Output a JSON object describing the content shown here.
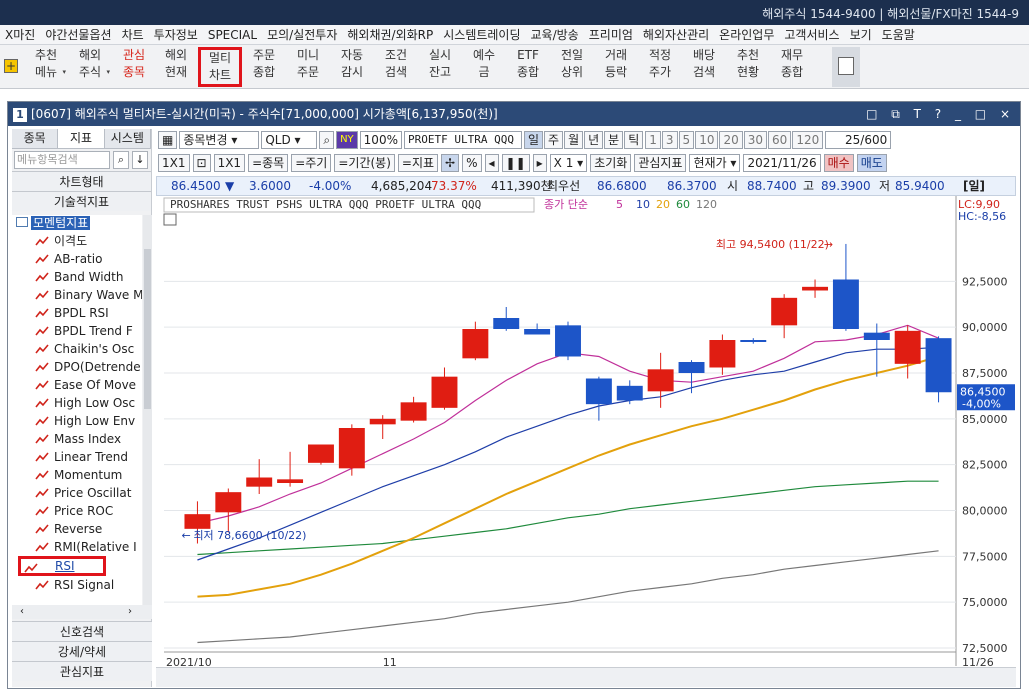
{
  "topbar": {
    "right": "해외주식 1544-9400 | 해외선물/FX마진 1544-9"
  },
  "menu": [
    "X마진",
    "야간선물옵션",
    "차트",
    "투자정보",
    "SPECIAL",
    "모의/실전투자",
    "해외채권/외화RP",
    "시스템트레이딩",
    "교육/방송",
    "프리미엄",
    "해외자산관리",
    "온라인업무",
    "고객서비스",
    "보기",
    "도움말"
  ],
  "toolbar": [
    {
      "l1": "추천",
      "l2": "메뉴",
      "dd": "▾"
    },
    {
      "l1": "해외",
      "l2": "주식",
      "dd": "▾"
    },
    {
      "l1": "관심",
      "l2": "종목",
      "red": true
    },
    {
      "l1": "해외",
      "l2": "현재"
    },
    {
      "l1": "멀티",
      "l2": "차트",
      "sel": true
    },
    {
      "l1": "주문",
      "l2": "종합"
    },
    {
      "l1": "미니",
      "l2": "주문"
    },
    {
      "l1": "자동",
      "l2": "감시"
    },
    {
      "l1": "조건",
      "l2": "검색"
    },
    {
      "l1": "실시",
      "l2": "잔고"
    },
    {
      "l1": "예수",
      "l2": "금"
    },
    {
      "l1": "ETF",
      "l2": "종합"
    },
    {
      "l1": "전일",
      "l2": "상위"
    },
    {
      "l1": "거래",
      "l2": "등락"
    },
    {
      "l1": "적정",
      "l2": "주가"
    },
    {
      "l1": "배당",
      "l2": "검색"
    },
    {
      "l1": "추천",
      "l2": "현황"
    },
    {
      "l1": "재무",
      "l2": "종합"
    }
  ],
  "window": {
    "num": "1",
    "title": "[0607] 해외주식 멀티차트-실시간(미국) - 주식수[71,000,000] 시가총액[6,137,950(천)]",
    "controls": "□ ⧉ T ? _ □ ×"
  },
  "left": {
    "tabs": [
      "종목",
      "지표",
      "시스템"
    ],
    "search_placeholder": "메뉴항목검색",
    "btn1": "차트형태",
    "btn2": "기술적지표",
    "root": "모멘텀지표",
    "items": [
      "이격도",
      "AB-ratio",
      "Band Width",
      "Binary Wave M",
      "BPDL RSI",
      "BPDL Trend F",
      "Chaikin's Osc",
      "DPO(Detrende",
      "Ease Of Move",
      "High Low Osc",
      "High Low Env",
      "Mass Index",
      "Linear Trend",
      "Momentum",
      "Price Oscillat",
      "Price ROC",
      "Reverse",
      "RMI(Relative I",
      "RSI",
      "RSI Signal"
    ],
    "selected": "RSI",
    "bottom": [
      "신호검색",
      "강세/약세",
      "관심지표"
    ]
  },
  "controls1": {
    "dropdown": "종목변경",
    "code": "QLD",
    "ny": "NY",
    "pct": "100%",
    "name": "PROETF ULTRA QQQ",
    "periods": [
      "일",
      "주",
      "월",
      "년",
      "분",
      "틱"
    ],
    "nums": [
      "1",
      "3",
      "5",
      "10",
      "20",
      "30",
      "60",
      "120"
    ],
    "count": "25/600"
  },
  "controls2": {
    "a": "1X1",
    "b": "1X1",
    "c": "=종목",
    "d": "=주기",
    "e": "=기간(봉)",
    "f": "=지표",
    "x": "X 1",
    "reset": "초기화",
    "interest": "관심지표",
    "price": "현재가",
    "date": "2021/11/26",
    "buy": "매수",
    "sell": "매도"
  },
  "quote": {
    "price": "86.4500",
    "arrow": "▼",
    "chg": "3.6000",
    "pct": "-4.00%",
    "vol": "4,685,204",
    "ratio": "73.37%",
    "amt": "411,390천",
    "best_label": "최우선",
    "ask": "86.6800",
    "bid": "86.3700",
    "open_l": "시",
    "open": "88.7400",
    "high_l": "고",
    "high": "89.3900",
    "low_l": "저",
    "low": "85.9400",
    "mode": "[일]"
  },
  "chart_header": {
    "name": "PROSHARES TRUST PSHS ULTRA QQQ  PROETF ULTRA QQQ",
    "ma_label": "종가 단순",
    "ma": [
      "5",
      "10",
      "20",
      "60",
      "120"
    ],
    "ma_colors": [
      "#c0309a",
      "#1f3ea8",
      "#e3a10c",
      "#1f8a3c",
      "#777777"
    ]
  },
  "chart_data": {
    "type": "candlestick",
    "ylim": [
      72.5,
      96.5
    ],
    "yticks": [
      "92,5000",
      "90,0000",
      "87,5000",
      "85,0000",
      "82,5000",
      "80,0000",
      "77,5000",
      "75,0000",
      "72,5000"
    ],
    "xlabels": [
      "2021/10",
      "11",
      "11/26"
    ],
    "candles": [
      {
        "o": 79.0,
        "h": 80.5,
        "l": 78.2,
        "c": 79.8
      },
      {
        "o": 79.9,
        "h": 81.2,
        "l": 78.8,
        "c": 81.0
      },
      {
        "o": 81.3,
        "h": 82.8,
        "l": 80.9,
        "c": 81.8
      },
      {
        "o": 81.5,
        "h": 83.2,
        "l": 81.3,
        "c": 81.7
      },
      {
        "o": 82.6,
        "h": 83.6,
        "l": 82.5,
        "c": 83.6
      },
      {
        "o": 82.3,
        "h": 84.7,
        "l": 81.9,
        "c": 84.5
      },
      {
        "o": 84.7,
        "h": 85.2,
        "l": 83.9,
        "c": 85.0
      },
      {
        "o": 84.9,
        "h": 86.2,
        "l": 84.8,
        "c": 85.9
      },
      {
        "o": 85.6,
        "h": 87.8,
        "l": 85.5,
        "c": 87.3
      },
      {
        "o": 88.3,
        "h": 90.3,
        "l": 88.2,
        "c": 89.9
      },
      {
        "o": 90.5,
        "h": 91.1,
        "l": 89.8,
        "c": 89.9
      },
      {
        "o": 89.9,
        "h": 90.2,
        "l": 89.6,
        "c": 89.6
      },
      {
        "o": 90.1,
        "h": 90.3,
        "l": 88.2,
        "c": 88.4
      },
      {
        "o": 87.2,
        "h": 87.3,
        "l": 84.9,
        "c": 85.8
      },
      {
        "o": 86.8,
        "h": 87.1,
        "l": 85.8,
        "c": 86.0
      },
      {
        "o": 86.5,
        "h": 88.6,
        "l": 85.6,
        "c": 87.7
      },
      {
        "o": 88.1,
        "h": 88.2,
        "l": 86.4,
        "c": 87.5
      },
      {
        "o": 87.8,
        "h": 89.6,
        "l": 87.4,
        "c": 89.3
      },
      {
        "o": 89.3,
        "h": 89.4,
        "l": 89.1,
        "c": 89.2
      },
      {
        "o": 90.1,
        "h": 91.8,
        "l": 89.4,
        "c": 91.6
      },
      {
        "o": 92.0,
        "h": 92.6,
        "l": 91.6,
        "c": 92.2
      },
      {
        "o": 92.6,
        "h": 94.54,
        "l": 89.8,
        "c": 89.9
      },
      {
        "o": 89.7,
        "h": 90.2,
        "l": 87.3,
        "c": 89.3
      },
      {
        "o": 88.0,
        "h": 90.1,
        "l": 87.2,
        "c": 89.8
      },
      {
        "o": 89.4,
        "h": 89.5,
        "l": 85.9,
        "c": 86.45
      }
    ],
    "ma5": [
      79.3,
      79.7,
      80.2,
      80.9,
      81.5,
      82.3,
      83.1,
      83.9,
      84.8,
      86.0,
      87.1,
      88.0,
      88.6,
      88.4,
      87.6,
      87.1,
      87.0,
      87.3,
      87.6,
      88.3,
      89.2,
      89.3,
      89.6,
      90.1,
      89.4
    ],
    "ma10": [
      77.3,
      77.9,
      78.5,
      79.2,
      79.9,
      80.6,
      81.3,
      81.9,
      82.5,
      83.2,
      84.0,
      84.6,
      85.2,
      85.7,
      86.0,
      86.2,
      86.7,
      87.1,
      87.4,
      87.6,
      88.1,
      88.6,
      88.8,
      88.8,
      88.9
    ],
    "ma20": [
      75.3,
      75.4,
      75.7,
      76.0,
      76.5,
      77.1,
      77.8,
      78.5,
      79.3,
      80.1,
      80.9,
      81.6,
      82.3,
      83.0,
      83.6,
      84.1,
      84.6,
      85.0,
      85.5,
      86.0,
      86.6,
      87.1,
      87.5,
      87.9,
      88.4
    ],
    "ma60": [
      77.6,
      77.7,
      77.8,
      77.9,
      78.0,
      78.1,
      78.2,
      78.4,
      78.6,
      78.8,
      79.0,
      79.3,
      79.6,
      79.8,
      80.1,
      80.3,
      80.5,
      80.7,
      80.9,
      81.1,
      81.3,
      81.4,
      81.5,
      81.6,
      81.6
    ],
    "ma120": [
      72.8,
      72.9,
      73.0,
      73.1,
      73.3,
      73.5,
      73.7,
      73.9,
      74.1,
      74.4,
      74.6,
      74.8,
      75.0,
      75.3,
      75.6,
      75.8,
      76.0,
      76.3,
      76.5,
      76.8,
      77.0,
      77.2,
      77.4,
      77.6,
      77.8
    ],
    "high_label": "최고 94,5400 (11/22)",
    "low_label": "최저 78,6600 (10/22)",
    "lc": "LC:9,90",
    "hc": "HC:-8,56",
    "last_price": "86,4500",
    "last_pct": "-4,00%"
  }
}
